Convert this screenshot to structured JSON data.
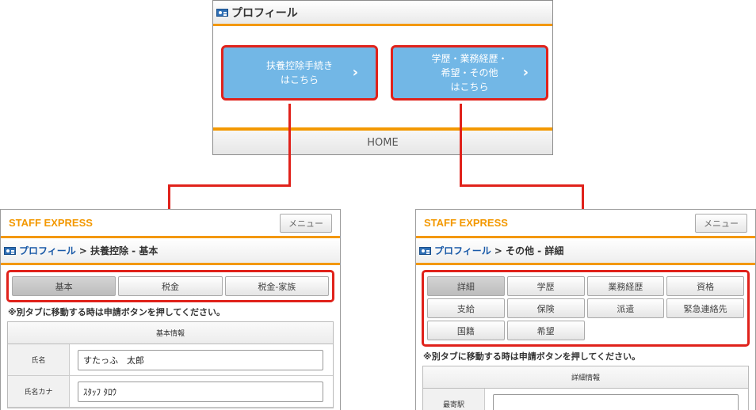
{
  "top_panel": {
    "title": "プロフィール",
    "button_a": {
      "line1": "扶養控除手続き",
      "line2": "はこちら",
      "chevron": "›"
    },
    "button_b": {
      "line1": "学歴・業務経歴・",
      "line2": "希望・その他",
      "line3": "はこちら",
      "chevron": "›"
    },
    "footer": "HOME"
  },
  "left_screen": {
    "brand": "STAFF EXPRESS",
    "menu_label": "メニュー",
    "breadcrumb_link": "プロフィール",
    "breadcrumb_rest": "> 扶養控除 - 基本",
    "tabs": [
      "基本",
      "税金",
      "税金-家族"
    ],
    "note": "※別タブに移動する時は申請ボタンを押してください。",
    "section_title": "基本情報",
    "fields": [
      {
        "label": "氏名",
        "value": "すたっふ　太郎"
      },
      {
        "label": "氏名カナ",
        "value": "ｽﾀｯﾌ ﾀﾛｳ"
      }
    ]
  },
  "right_screen": {
    "brand": "STAFF EXPRESS",
    "menu_label": "メニュー",
    "breadcrumb_link": "プロフィール",
    "breadcrumb_rest": "> その他 - 詳細",
    "tabs_row1": [
      "詳細",
      "学歴",
      "業務経歴",
      "資格"
    ],
    "tabs_row2": [
      "支給",
      "保険",
      "派遣",
      "緊急連絡先"
    ],
    "tabs_row3": [
      "国籍",
      "希望"
    ],
    "note": "※別タブに移動する時は申請ボタンを押してください。",
    "section_title": "詳細情報",
    "first_field_label": "最寄駅"
  },
  "colors": {
    "accent_orange": "#f39800",
    "highlight_red": "#e0221b",
    "button_blue": "#72b7e6",
    "link_blue": "#1a5aa8"
  },
  "icons": [
    "profile-card-icon"
  ]
}
